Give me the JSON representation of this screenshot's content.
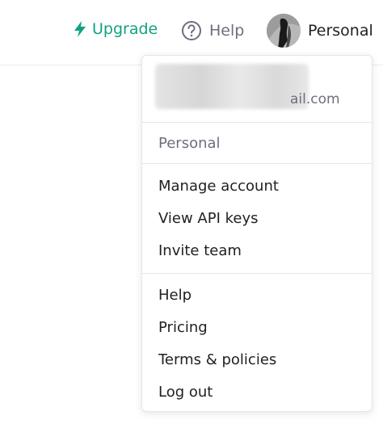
{
  "theme": {
    "accent": "#10a37f"
  },
  "header": {
    "upgrade_label": "Upgrade",
    "upgrade_icon": "lightning-bolt-icon",
    "help_label": "Help",
    "help_icon": "question-circle-icon",
    "account_label": "Personal"
  },
  "menu": {
    "email_suffix": "ail.com",
    "workspace": "Personal",
    "account_items": [
      "Manage account",
      "View API keys",
      "Invite team"
    ],
    "support_items": [
      "Help",
      "Pricing",
      "Terms & policies",
      "Log out"
    ]
  }
}
